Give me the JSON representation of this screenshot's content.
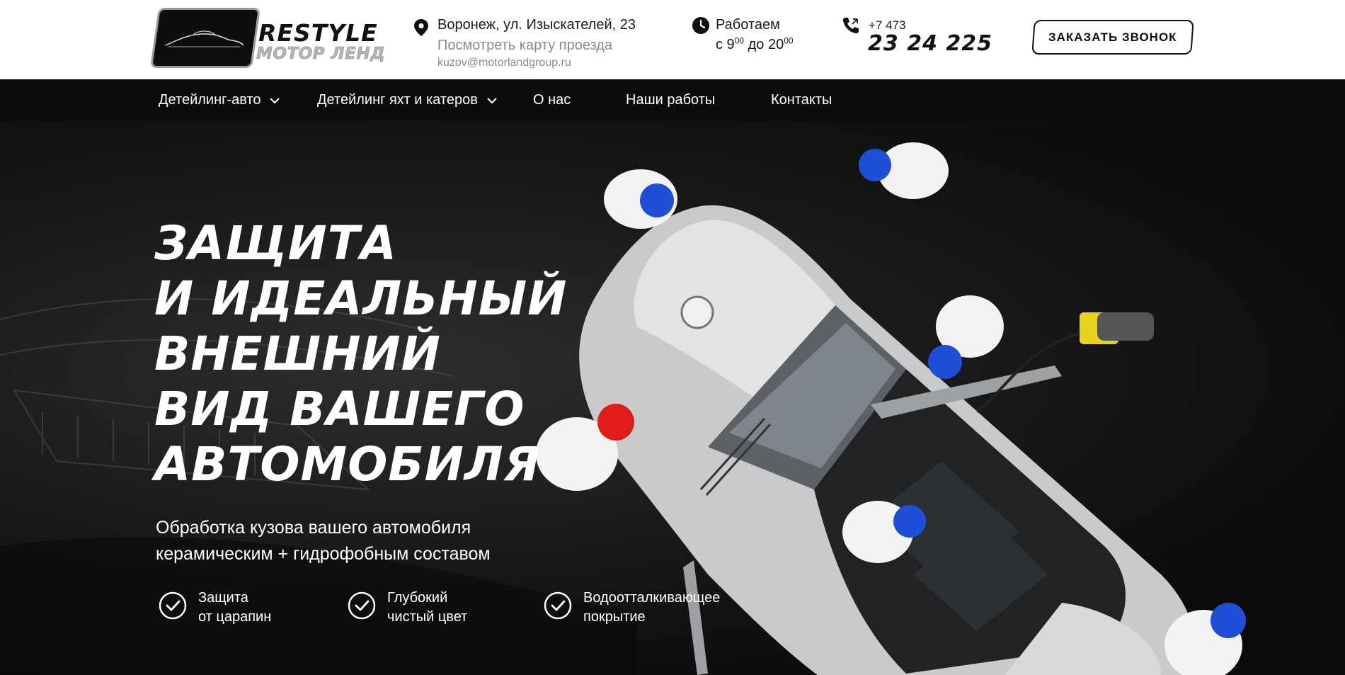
{
  "header": {
    "logo": {
      "line1": "RESTYLE",
      "line2": "МОТОР ЛЕНД"
    },
    "address": "Воронеж, ул. Изыскателей, 23",
    "map_link": "Посмотреть карту проезда",
    "email": "kuzov@motorlandgroup.ru",
    "hours": {
      "line1": "Работаем",
      "from_prefix": "с 9",
      "from_sup": "00",
      "to_prefix": " до 20",
      "to_sup": "00"
    },
    "phone": {
      "code": "+7 473",
      "number": "23 24 225"
    },
    "call_button": "ЗАКАЗАТЬ ЗВОНОК",
    "icons": [
      "map-pin-icon",
      "clock-icon",
      "phone-icon"
    ]
  },
  "nav": {
    "items": [
      {
        "label": "Детейлинг-авто",
        "has_dropdown": true
      },
      {
        "label": "Детейлинг яхт и катеров",
        "has_dropdown": true
      },
      {
        "label": "О нас",
        "has_dropdown": false
      },
      {
        "label": "Наши работы",
        "has_dropdown": false
      },
      {
        "label": "Контакты",
        "has_dropdown": false
      }
    ]
  },
  "hero": {
    "title_lines": [
      "ЗАЩИТА",
      "И ИДЕАЛЬНЫЙ",
      "ВНЕШНИЙ",
      "ВИД ВАШЕГО",
      "АВТОМОБИЛЯ"
    ],
    "subtitle_lines": [
      "Обработка кузова вашего автомобиля",
      "керамическим + гидрофобным составом"
    ],
    "features": [
      {
        "line1": "Защита",
        "line2": "от царапин"
      },
      {
        "line1": "Глубокий",
        "line2": "чистый цвет"
      },
      {
        "line1": "Водоотталкивающее",
        "line2": "покрытие"
      }
    ]
  },
  "colors": {
    "nav_bg": "#0b0b0b",
    "hero_bg": "#1a1a1b",
    "text_muted": "#8a8a8a",
    "cap_blue": "#1f4fd6",
    "cap_red": "#e21b1b"
  }
}
